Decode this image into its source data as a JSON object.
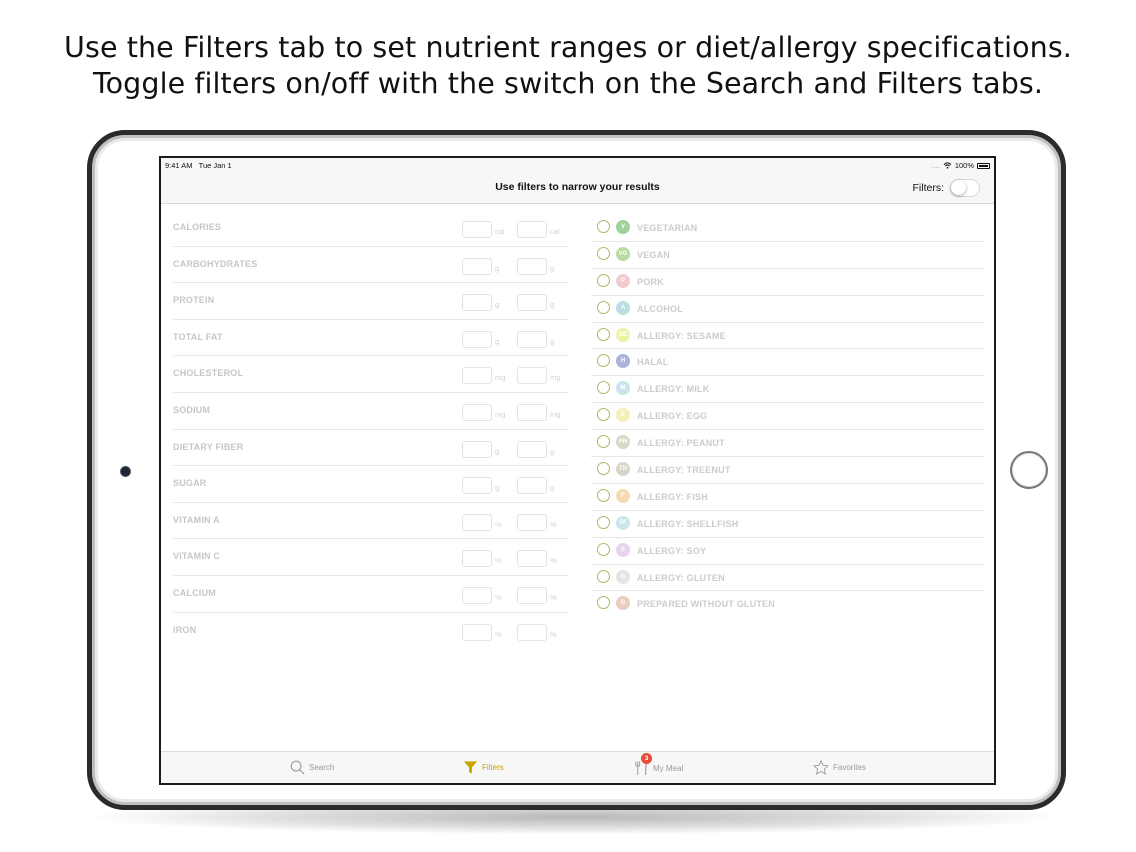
{
  "caption": {
    "line1": "Use the Filters tab to set nutrient ranges or diet/allergy specifications.",
    "line2": "Toggle filters on/off with the switch on the Search and Filters tabs."
  },
  "status_bar": {
    "time": "9:41 AM",
    "date": "Tue Jan 1",
    "signal": "....",
    "battery": "100%"
  },
  "navbar": {
    "title": "Use filters to narrow your results",
    "filters_label": "Filters:",
    "filters_on": false
  },
  "nutrients": [
    {
      "label": "CALORIES",
      "unit": "cal"
    },
    {
      "label": "CARBOHYDRATES",
      "unit": "g"
    },
    {
      "label": "PROTEIN",
      "unit": "g"
    },
    {
      "label": "TOTAL FAT",
      "unit": "g"
    },
    {
      "label": "CHOLESTEROL",
      "unit": "mg"
    },
    {
      "label": "SODIUM",
      "unit": "mg"
    },
    {
      "label": "DIETARY FIBER",
      "unit": "g"
    },
    {
      "label": "SUGAR",
      "unit": "g"
    },
    {
      "label": "VITAMIN A",
      "unit": "%"
    },
    {
      "label": "VITAMIN C",
      "unit": "%"
    },
    {
      "label": "CALCIUM",
      "unit": "%"
    },
    {
      "label": "IRON",
      "unit": "%"
    }
  ],
  "diets": [
    {
      "abbr": "V",
      "label": "VEGETARIAN",
      "color": "#9fd19a"
    },
    {
      "abbr": "VG",
      "label": "VEGAN",
      "color": "#b9dba3"
    },
    {
      "abbr": "P",
      "label": "PORK",
      "color": "#f2c9cf"
    },
    {
      "abbr": "A",
      "label": "ALCOHOL",
      "color": "#bcdde3"
    },
    {
      "abbr": "SE",
      "label": "ALLERGY: SESAME",
      "color": "#eef2a8"
    },
    {
      "abbr": "H",
      "label": "HALAL",
      "color": "#a9b4d8"
    },
    {
      "abbr": "M",
      "label": "ALLERGY: MILK",
      "color": "#c9e4ec"
    },
    {
      "abbr": "E",
      "label": "ALLERGY: EGG",
      "color": "#f3f0b9"
    },
    {
      "abbr": "PN",
      "label": "ALLERGY: PEANUT",
      "color": "#d5d9c6"
    },
    {
      "abbr": "TN",
      "label": "ALLERGY: TREENUT",
      "color": "#d9d6c9"
    },
    {
      "abbr": "F",
      "label": "ALLERGY: FISH",
      "color": "#f6dab0"
    },
    {
      "abbr": "SF",
      "label": "ALLERGY: SHELLFISH",
      "color": "#c6e6ea"
    },
    {
      "abbr": "S",
      "label": "ALLERGY: SOY",
      "color": "#e7d3ee"
    },
    {
      "abbr": "G",
      "label": "ALLERGY: GLUTEN",
      "color": "#e4e4e4"
    },
    {
      "abbr": "G",
      "label": "PREPARED WITHOUT GLUTEN",
      "color": "#ebcdbf"
    }
  ],
  "tabs": [
    {
      "label": "Search",
      "icon": "search-icon",
      "active": false
    },
    {
      "label": "Filters",
      "icon": "filter-icon",
      "active": true
    },
    {
      "label": "My Meal",
      "icon": "fork-knife-icon",
      "active": false,
      "badge": "3"
    },
    {
      "label": "Favorites",
      "icon": "star-icon",
      "active": false
    }
  ],
  "colors": {
    "accent": "#c8a400",
    "radio_border": "#b0b56a",
    "tab_badge": "#e74c3c"
  }
}
